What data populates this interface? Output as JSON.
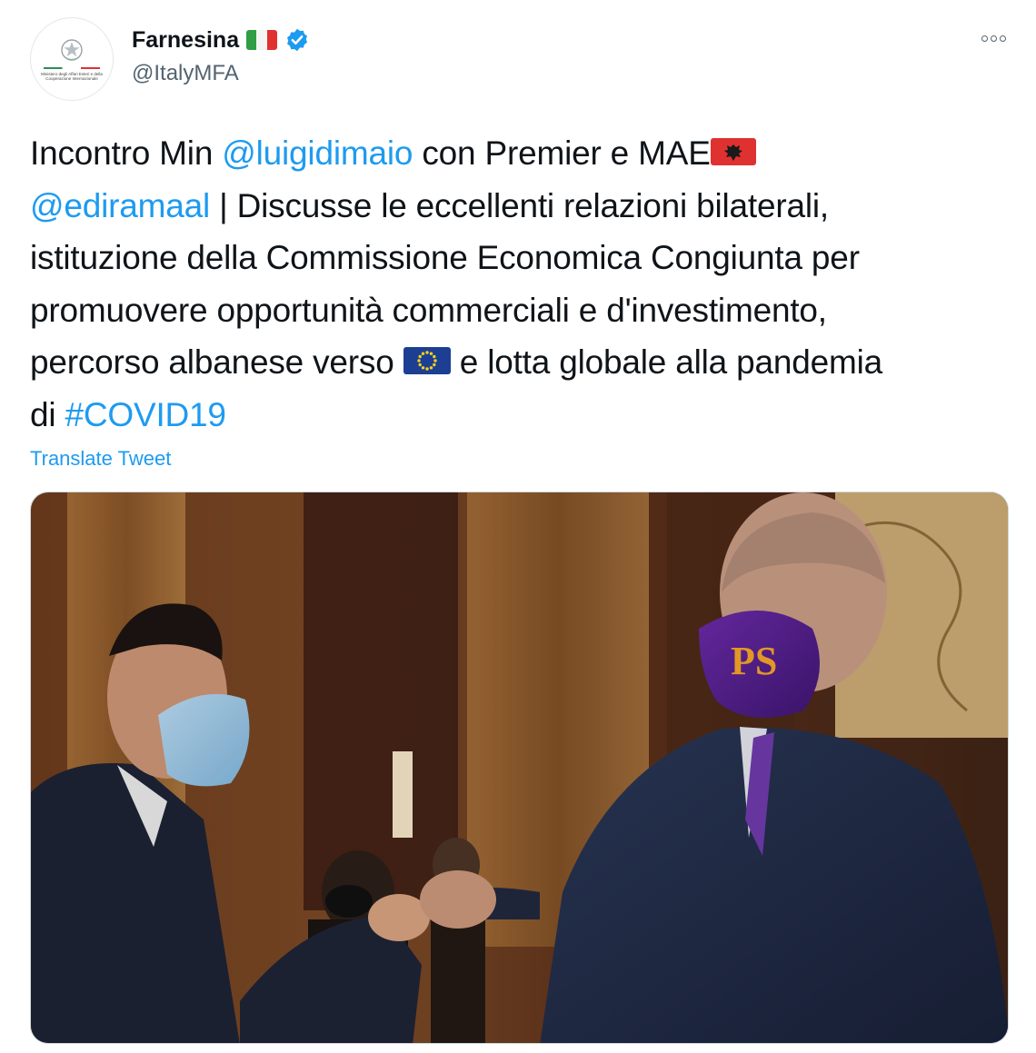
{
  "account": {
    "display_name": "Farnesina",
    "handle": "@ItalyMFA",
    "avatar_caption": "Ministero degli Affari Esteri e della Cooperazione Internazionale",
    "flag_icon": "flag-italy-icon",
    "verified_icon": "verified-badge-icon",
    "verified_color": "#1d9bf0"
  },
  "tweet": {
    "line1_pre": "Incontro Min ",
    "mention1": "@luigidimaio",
    "line1_post": " con Premier e MAE",
    "mention2": "@ediramaal",
    "line2_post": " | Discusse le eccellenti relazioni bilaterali,",
    "line3": "istituzione della Commissione Economica Congiunta per",
    "line4": "promuovere opportunità commerciali e d'investimento,",
    "line5_pre": "percorso albanese verso ",
    "line5_post": " e lotta globale alla pandemia",
    "line6_pre": "di ",
    "hashtag": "#COVID19",
    "link_color": "#1d9bf0"
  },
  "actions": {
    "translate_label": "Translate Tweet",
    "more_icon": "more-options-icon"
  },
  "media": {
    "photo_icon": "tweet-photo"
  }
}
